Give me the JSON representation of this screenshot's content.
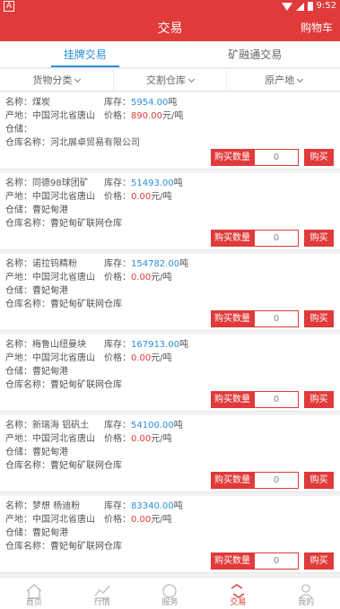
{
  "status": {
    "left_badge": "A",
    "time": "9:52"
  },
  "header": {
    "title": "交易",
    "cart_label": "购物车"
  },
  "tabs": [
    {
      "label": "挂牌交易",
      "active": true
    },
    {
      "label": "矿融通交易",
      "active": false
    }
  ],
  "filters": [
    {
      "label": "货物分类"
    },
    {
      "label": "交割仓库"
    },
    {
      "label": "原产地"
    }
  ],
  "labels": {
    "name": "名称：",
    "stock": "库存：",
    "origin": "产地：",
    "price": "价格：",
    "warehouse": "仓储：",
    "warehouse_name": "仓库名称：",
    "stock_unit": "吨",
    "price_unit": "元/吨",
    "qty_label": "购买数量",
    "buy": "购买"
  },
  "items": [
    {
      "name": "煤炭",
      "stock": "5954.00",
      "origin": "中国河北省唐山",
      "price": "890.00",
      "warehouse": "",
      "warehouse_name": "河北展卓贸易有限公司",
      "qty": "0"
    },
    {
      "name": "同德98球团矿",
      "stock": "51493.00",
      "origin": "中国河北省唐山",
      "price": "0.00",
      "warehouse": "曹妃甸港",
      "warehouse_name": "曹妃甸矿联网仓库",
      "qty": "0"
    },
    {
      "name": "诺拉钨精粉",
      "stock": "154782.00",
      "origin": "中国河北省唐山",
      "price": "0.00",
      "warehouse": "曹妃甸港",
      "warehouse_name": "曹妃甸矿联网仓库",
      "qty": "0"
    },
    {
      "name": "梅鲁山纽曼块",
      "stock": "167913.00",
      "origin": "中国河北省唐山",
      "price": "0.00",
      "warehouse": "曹妃甸港",
      "warehouse_name": "曹妃甸矿联网仓库",
      "qty": "0"
    },
    {
      "name": "新瑞海 铝矾土",
      "stock": "54100.00",
      "origin": "中国河北省唐山",
      "price": "0.00",
      "warehouse": "曹妃甸港",
      "warehouse_name": "曹妃甸矿联网仓库",
      "qty": "0"
    },
    {
      "name": "梦想 杨迪粉",
      "stock": "83340.00",
      "origin": "中国河北省唐山",
      "price": "0.00",
      "warehouse": "曹妃甸港",
      "warehouse_name": "曹妃甸矿联网仓库",
      "qty": "0"
    }
  ],
  "nav": [
    {
      "label": "首页",
      "icon": "home-icon",
      "active": false
    },
    {
      "label": "行情",
      "icon": "chart-icon",
      "active": false
    },
    {
      "label": "服务",
      "icon": "service-icon",
      "active": false
    },
    {
      "label": "交易",
      "icon": "trade-icon",
      "active": true
    },
    {
      "label": "我的",
      "icon": "user-icon",
      "active": false
    }
  ]
}
